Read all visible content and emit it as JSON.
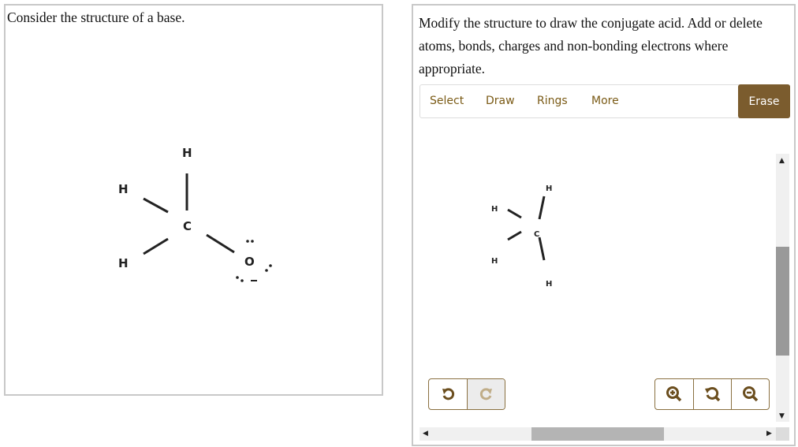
{
  "left_panel": {
    "prompt": "Consider the structure of a base.",
    "molecule": {
      "atoms": [
        "H",
        "H",
        "H",
        "C",
        "O"
      ],
      "charge": "−",
      "lone_pairs_on_oxygen": 3
    }
  },
  "right_panel": {
    "prompt": "Modify the structure to draw the conjugate acid. Add or delete atoms, bonds, charges and non-bonding electrons where appropriate.",
    "toolbar": {
      "tabs": [
        "Select",
        "Draw",
        "Rings",
        "More"
      ],
      "erase_label": "Erase"
    },
    "molecule": {
      "atoms": [
        "H",
        "H",
        "C",
        "H",
        "H"
      ]
    },
    "controls": {
      "undo": "undo-icon",
      "redo": "redo-icon",
      "zoom_in": "zoom-in-icon",
      "zoom_reset": "zoom-reset-icon",
      "zoom_out": "zoom-out-icon"
    },
    "colors": {
      "accent": "#7b5c2e",
      "tab_text": "#7a5a15"
    }
  }
}
